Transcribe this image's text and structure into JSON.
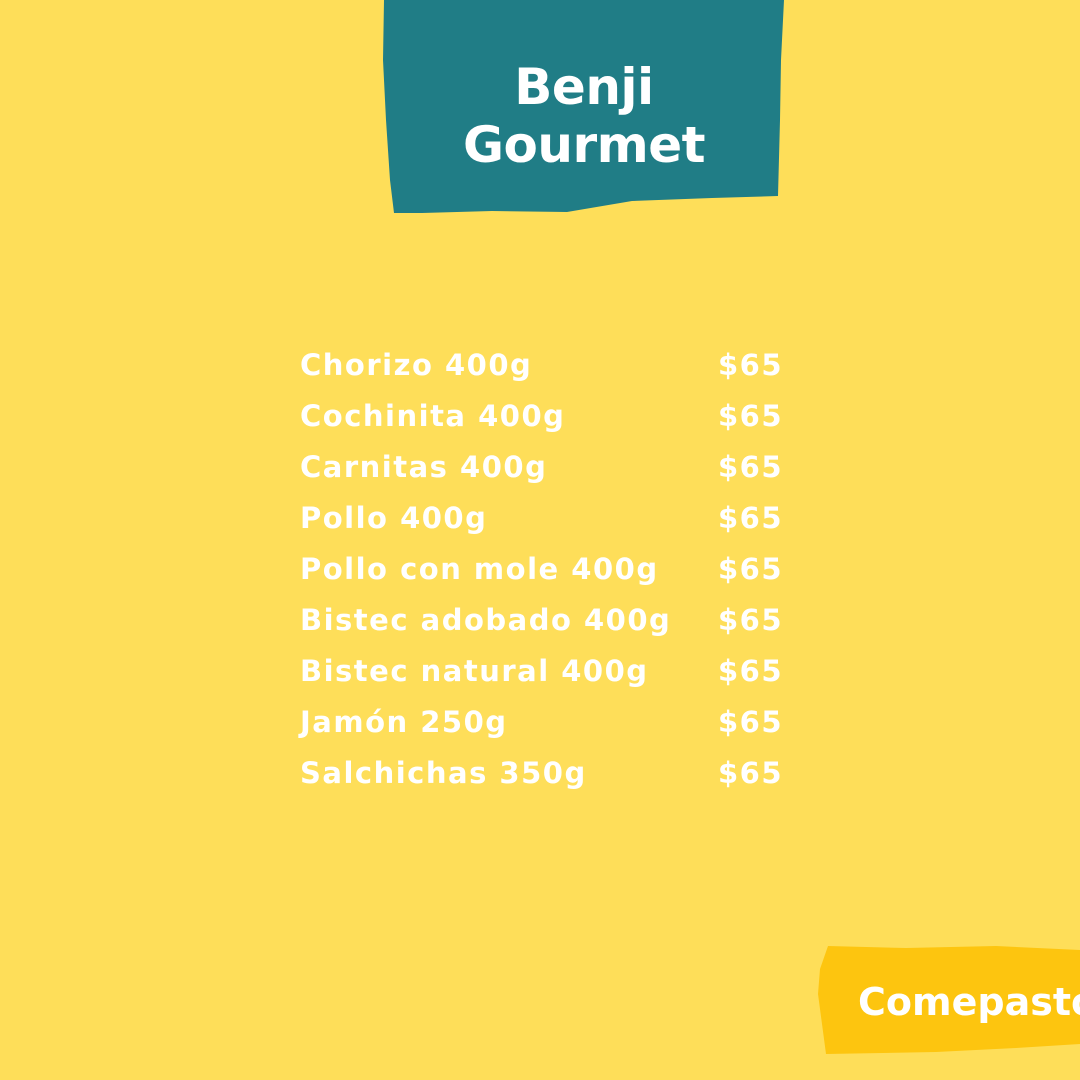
{
  "brand": {
    "title_line1": "Benji",
    "title_line2": "Gourmet",
    "banner_color": "#207D86",
    "background_color": "#FEDE59"
  },
  "menu": {
    "items": [
      {
        "name": "Chorizo 400g",
        "price": "$65"
      },
      {
        "name": "Cochinita 400g",
        "price": "$65"
      },
      {
        "name": "Carnitas 400g",
        "price": "$65"
      },
      {
        "name": "Pollo 400g",
        "price": "$65"
      },
      {
        "name": "Pollo con mole 400g",
        "price": "$65"
      },
      {
        "name": "Bistec adobado 400g",
        "price": "$65"
      },
      {
        "name": "Bistec natural 400g",
        "price": "$65"
      },
      {
        "name": "Jamón 250g",
        "price": "$65"
      },
      {
        "name": "Salchichas 350g",
        "price": "$65"
      }
    ]
  },
  "footer": {
    "label": "Comepasto",
    "tag_color": "#FDC50F"
  }
}
